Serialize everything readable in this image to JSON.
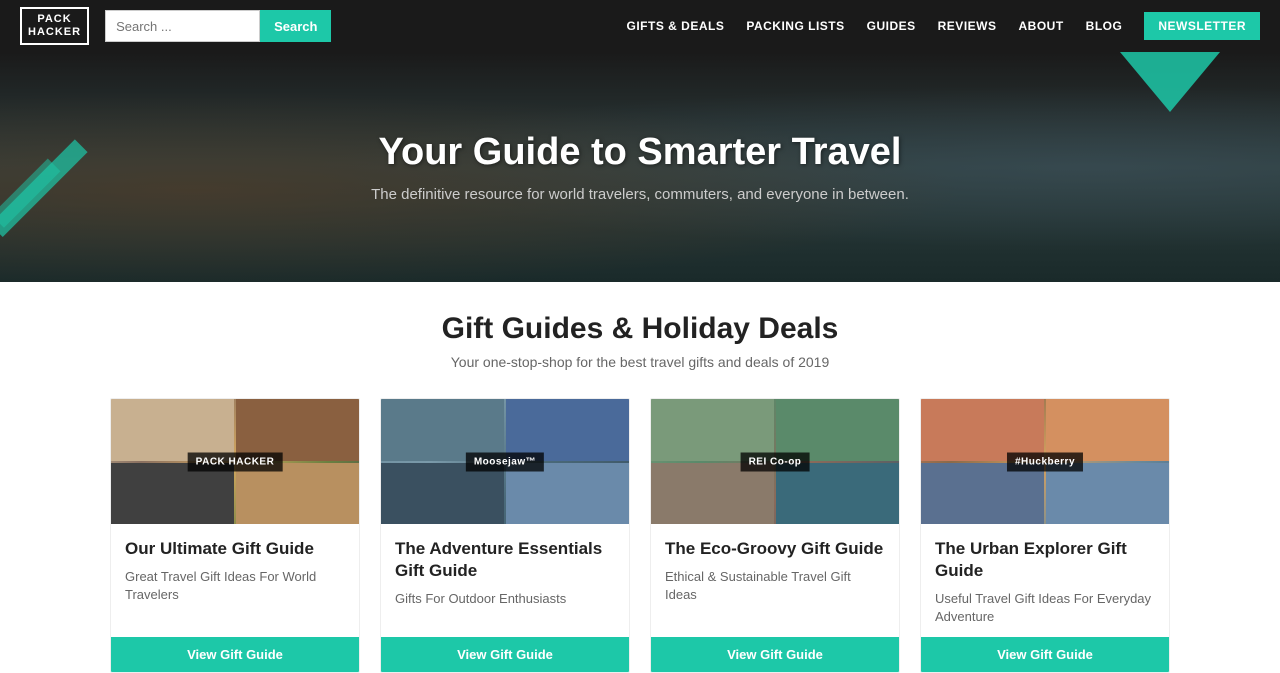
{
  "header": {
    "logo_line1": "PACK",
    "logo_line2": "HACKER",
    "search_placeholder": "Search ...",
    "search_button": "Search",
    "nav_items": [
      {
        "label": "GIFTS & DEALS",
        "href": "#"
      },
      {
        "label": "PACKING LISTS",
        "href": "#"
      },
      {
        "label": "GUIDES",
        "href": "#"
      },
      {
        "label": "REVIEWS",
        "href": "#"
      },
      {
        "label": "ABOUT",
        "href": "#"
      },
      {
        "label": "BLOG",
        "href": "#"
      }
    ],
    "newsletter_label": "NEWSLETTER"
  },
  "hero": {
    "title": "Your Guide to Smarter Travel",
    "subtitle": "The definitive resource for world travelers, commuters, and everyone in between."
  },
  "section": {
    "title": "Gift Guides & Holiday Deals",
    "subtitle": "Your one-stop-shop for the best travel gifts and deals of 2019"
  },
  "cards": [
    {
      "badge": "PACK HACKER",
      "title": "Our Ultimate Gift Guide",
      "desc": "Great Travel Gift Ideas For World Travelers",
      "btn": "View Gift Guide"
    },
    {
      "badge": "Moosejaw™",
      "title": "The Adventure Essentials Gift Guide",
      "desc": "Gifts For Outdoor Enthusiasts",
      "btn": "View Gift Guide"
    },
    {
      "badge": "REI Co-op",
      "title": "The Eco-Groovy Gift Guide",
      "desc": "Ethical & Sustainable Travel Gift Ideas",
      "btn": "View Gift Guide"
    },
    {
      "badge": "#Huckberry",
      "title": "The Urban Explorer Gift Guide",
      "desc": "Useful Travel Gift Ideas For Everyday Adventure",
      "btn": "View Gift Guide"
    }
  ]
}
